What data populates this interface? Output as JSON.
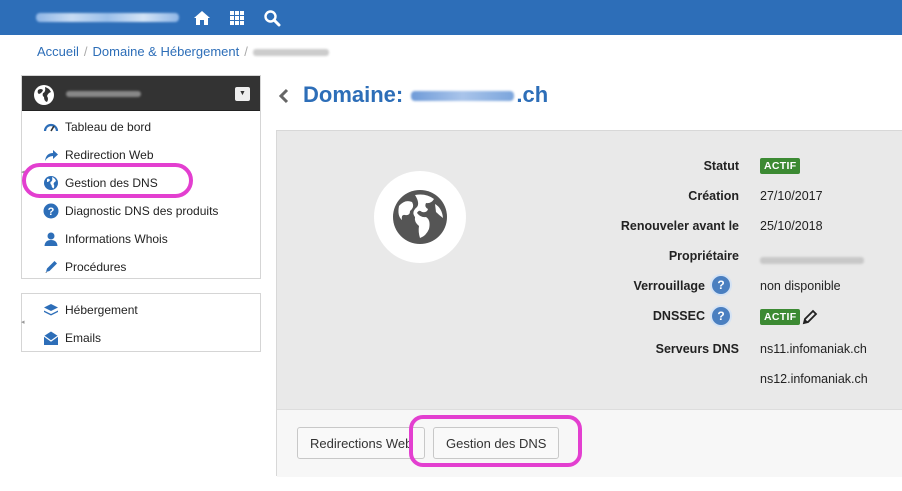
{
  "topbar": {
    "icons": [
      "home-icon",
      "grid-icon",
      "search-icon"
    ]
  },
  "breadcrumb": {
    "home": "Accueil",
    "section": "Domaine & Hébergement",
    "separator": "/"
  },
  "sidebar": {
    "main_items": [
      {
        "label": "Tableau de bord",
        "icon": "dashboard-icon"
      },
      {
        "label": "Redirection Web",
        "icon": "redirect-icon"
      },
      {
        "label": "Gestion des DNS",
        "icon": "globe-icon"
      },
      {
        "label": "Diagnostic DNS des produits",
        "icon": "help-icon"
      },
      {
        "label": "Informations Whois",
        "icon": "user-icon"
      },
      {
        "label": "Procédures",
        "icon": "pencil-icon"
      }
    ],
    "other_items": [
      {
        "label": "Hébergement",
        "icon": "stack-icon"
      },
      {
        "label": "Emails",
        "icon": "mail-icon"
      }
    ]
  },
  "page": {
    "title_prefix": "Domaine:",
    "title_suffix": ".ch"
  },
  "details": {
    "statut": {
      "label": "Statut",
      "value": "ACTIF"
    },
    "creation": {
      "label": "Création",
      "value": "27/10/2017"
    },
    "renouveler": {
      "label": "Renouveler avant le",
      "value": "25/10/2018"
    },
    "proprietaire": {
      "label": "Propriétaire"
    },
    "verrouillage": {
      "label": "Verrouillage",
      "help": "?",
      "value": "non disponible"
    },
    "dnssec": {
      "label": "DNSSEC",
      "help": "?",
      "value": "ACTIF"
    },
    "serveurs": {
      "label": "Serveurs DNS",
      "values": [
        "ns11.infomaniak.ch",
        "ns12.infomaniak.ch"
      ]
    }
  },
  "buttons": {
    "redirections": "Redirections Web",
    "gestion_dns": "Gestion des DNS"
  },
  "colors": {
    "brand_blue": "#2d6eb8",
    "active_green": "#3c8a33",
    "highlight": "#e33fd0"
  }
}
